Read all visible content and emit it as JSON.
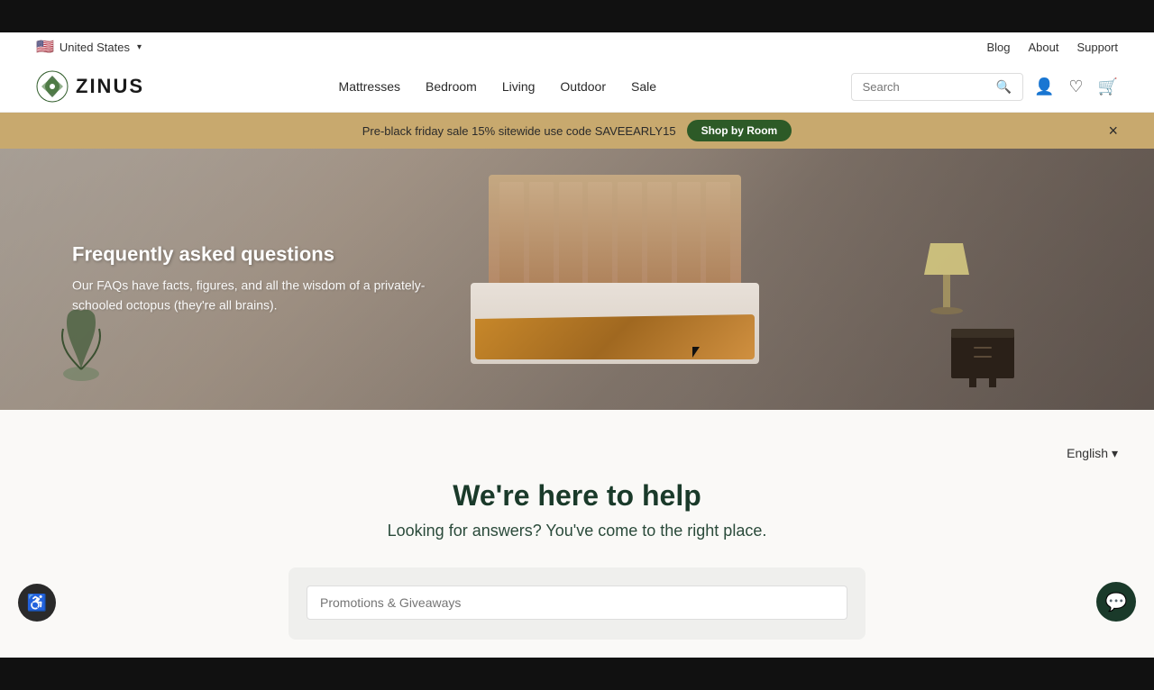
{
  "black_bars": {
    "show": true
  },
  "utility_nav": {
    "country": "United States",
    "country_flag": "🇺🇸",
    "links": [
      {
        "label": "Blog",
        "href": "#"
      },
      {
        "label": "About",
        "href": "#"
      },
      {
        "label": "Support",
        "href": "#"
      }
    ]
  },
  "main_nav": {
    "logo_text": "ZINUS",
    "nav_links": [
      {
        "label": "Mattresses",
        "href": "#"
      },
      {
        "label": "Bedroom",
        "href": "#"
      },
      {
        "label": "Living",
        "href": "#"
      },
      {
        "label": "Outdoor",
        "href": "#"
      },
      {
        "label": "Sale",
        "href": "#"
      }
    ],
    "search_placeholder": "Search"
  },
  "promo_banner": {
    "text": "Pre-black friday sale 15% sitewide use code SAVEEARLY15",
    "button_label": "Shop by Room",
    "close_label": "×"
  },
  "hero": {
    "title": "Frequently asked questions",
    "description": "Our FAQs have facts, figures, and all the wisdom of a privately-schooled octopus (they're all brains)."
  },
  "faq_section": {
    "lang_label": "English",
    "heading": "We're here to help",
    "subheading": "Looking for answers? You've come to the right place.",
    "search_placeholder": "Promotions & Giveaways"
  },
  "accessibility_btn": {
    "label": "♿"
  },
  "chat_btn": {
    "label": "💬"
  }
}
